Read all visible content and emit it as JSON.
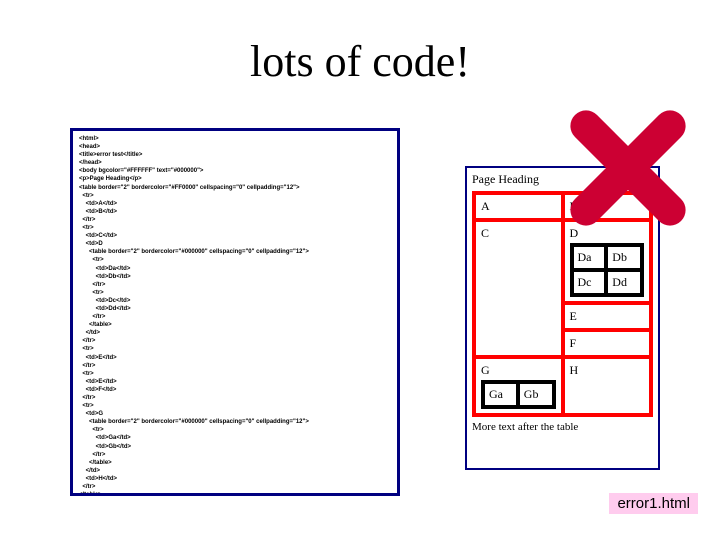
{
  "title": "lots of code!",
  "caption": "error1.html",
  "code": "<html>\n<head>\n<title>error test</title>\n</head>\n<body bgcolor=\"#FFFFFF\" text=\"#000000\">\n<p>Page Heading</p>\n<table border=\"2\" bordercolor=\"#FF0000\" cellspacing=\"0\" cellpadding=\"12\">\n  <tr>\n    <td>A</td>\n    <td>B</td>\n  </tr>\n  <tr>\n    <td>C</td>\n    <td>D\n      <table border=\"2\" bordercolor=\"#000000\" cellspacing=\"0\" cellpadding=\"12\">\n        <tr>\n          <td>Da</td>\n          <td>Db</td>\n        </tr>\n        <tr>\n          <td>Dc</td>\n          <td>Dd</td>\n        </tr>\n      </table>\n    </td>\n  </tr>\n  <tr>\n    <td>E</td>\n  </tr>\n  <tr>\n    <td>E</td>\n    <td>F</td>\n  </tr>\n  <tr>\n    <td>G\n      <table border=\"2\" bordercolor=\"#000000\" cellspacing=\"0\" cellpadding=\"12\">\n        <tr>\n          <td>Ga</td>\n          <td>Gb</td>\n        </tr>\n      </table>\n    </td>\n    <td>H</td>\n  </tr>\n</table>\n<p>More text after the table</p>\n</body>\n</html>",
  "rendered": {
    "heading": "Page Heading",
    "after": "More text after the table",
    "outer_rows": [
      [
        "A",
        "B"
      ],
      [
        "C",
        "D"
      ],
      [
        "E",
        "F"
      ],
      [
        "G",
        "H"
      ]
    ],
    "inner_D": [
      [
        "Da",
        "Db"
      ],
      [
        "Dc",
        "Dd"
      ]
    ],
    "inner_G": [
      [
        "Ga",
        "Gb"
      ]
    ]
  }
}
